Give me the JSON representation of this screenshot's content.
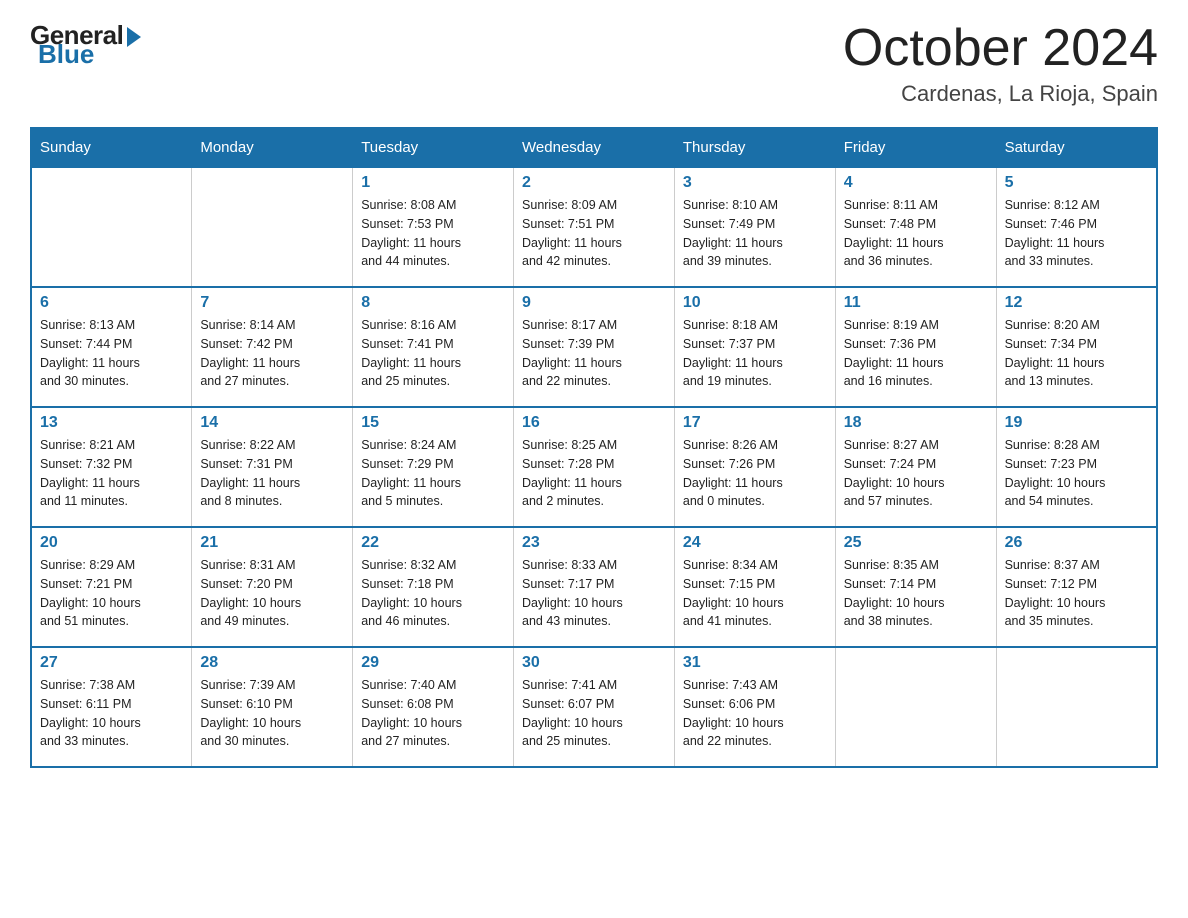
{
  "header": {
    "logo": {
      "general": "General",
      "blue": "Blue"
    },
    "title": "October 2024",
    "location": "Cardenas, La Rioja, Spain"
  },
  "days_of_week": [
    "Sunday",
    "Monday",
    "Tuesday",
    "Wednesday",
    "Thursday",
    "Friday",
    "Saturday"
  ],
  "weeks": [
    [
      {
        "day": "",
        "info": ""
      },
      {
        "day": "",
        "info": ""
      },
      {
        "day": "1",
        "info": "Sunrise: 8:08 AM\nSunset: 7:53 PM\nDaylight: 11 hours\nand 44 minutes."
      },
      {
        "day": "2",
        "info": "Sunrise: 8:09 AM\nSunset: 7:51 PM\nDaylight: 11 hours\nand 42 minutes."
      },
      {
        "day": "3",
        "info": "Sunrise: 8:10 AM\nSunset: 7:49 PM\nDaylight: 11 hours\nand 39 minutes."
      },
      {
        "day": "4",
        "info": "Sunrise: 8:11 AM\nSunset: 7:48 PM\nDaylight: 11 hours\nand 36 minutes."
      },
      {
        "day": "5",
        "info": "Sunrise: 8:12 AM\nSunset: 7:46 PM\nDaylight: 11 hours\nand 33 minutes."
      }
    ],
    [
      {
        "day": "6",
        "info": "Sunrise: 8:13 AM\nSunset: 7:44 PM\nDaylight: 11 hours\nand 30 minutes."
      },
      {
        "day": "7",
        "info": "Sunrise: 8:14 AM\nSunset: 7:42 PM\nDaylight: 11 hours\nand 27 minutes."
      },
      {
        "day": "8",
        "info": "Sunrise: 8:16 AM\nSunset: 7:41 PM\nDaylight: 11 hours\nand 25 minutes."
      },
      {
        "day": "9",
        "info": "Sunrise: 8:17 AM\nSunset: 7:39 PM\nDaylight: 11 hours\nand 22 minutes."
      },
      {
        "day": "10",
        "info": "Sunrise: 8:18 AM\nSunset: 7:37 PM\nDaylight: 11 hours\nand 19 minutes."
      },
      {
        "day": "11",
        "info": "Sunrise: 8:19 AM\nSunset: 7:36 PM\nDaylight: 11 hours\nand 16 minutes."
      },
      {
        "day": "12",
        "info": "Sunrise: 8:20 AM\nSunset: 7:34 PM\nDaylight: 11 hours\nand 13 minutes."
      }
    ],
    [
      {
        "day": "13",
        "info": "Sunrise: 8:21 AM\nSunset: 7:32 PM\nDaylight: 11 hours\nand 11 minutes."
      },
      {
        "day": "14",
        "info": "Sunrise: 8:22 AM\nSunset: 7:31 PM\nDaylight: 11 hours\nand 8 minutes."
      },
      {
        "day": "15",
        "info": "Sunrise: 8:24 AM\nSunset: 7:29 PM\nDaylight: 11 hours\nand 5 minutes."
      },
      {
        "day": "16",
        "info": "Sunrise: 8:25 AM\nSunset: 7:28 PM\nDaylight: 11 hours\nand 2 minutes."
      },
      {
        "day": "17",
        "info": "Sunrise: 8:26 AM\nSunset: 7:26 PM\nDaylight: 11 hours\nand 0 minutes."
      },
      {
        "day": "18",
        "info": "Sunrise: 8:27 AM\nSunset: 7:24 PM\nDaylight: 10 hours\nand 57 minutes."
      },
      {
        "day": "19",
        "info": "Sunrise: 8:28 AM\nSunset: 7:23 PM\nDaylight: 10 hours\nand 54 minutes."
      }
    ],
    [
      {
        "day": "20",
        "info": "Sunrise: 8:29 AM\nSunset: 7:21 PM\nDaylight: 10 hours\nand 51 minutes."
      },
      {
        "day": "21",
        "info": "Sunrise: 8:31 AM\nSunset: 7:20 PM\nDaylight: 10 hours\nand 49 minutes."
      },
      {
        "day": "22",
        "info": "Sunrise: 8:32 AM\nSunset: 7:18 PM\nDaylight: 10 hours\nand 46 minutes."
      },
      {
        "day": "23",
        "info": "Sunrise: 8:33 AM\nSunset: 7:17 PM\nDaylight: 10 hours\nand 43 minutes."
      },
      {
        "day": "24",
        "info": "Sunrise: 8:34 AM\nSunset: 7:15 PM\nDaylight: 10 hours\nand 41 minutes."
      },
      {
        "day": "25",
        "info": "Sunrise: 8:35 AM\nSunset: 7:14 PM\nDaylight: 10 hours\nand 38 minutes."
      },
      {
        "day": "26",
        "info": "Sunrise: 8:37 AM\nSunset: 7:12 PM\nDaylight: 10 hours\nand 35 minutes."
      }
    ],
    [
      {
        "day": "27",
        "info": "Sunrise: 7:38 AM\nSunset: 6:11 PM\nDaylight: 10 hours\nand 33 minutes."
      },
      {
        "day": "28",
        "info": "Sunrise: 7:39 AM\nSunset: 6:10 PM\nDaylight: 10 hours\nand 30 minutes."
      },
      {
        "day": "29",
        "info": "Sunrise: 7:40 AM\nSunset: 6:08 PM\nDaylight: 10 hours\nand 27 minutes."
      },
      {
        "day": "30",
        "info": "Sunrise: 7:41 AM\nSunset: 6:07 PM\nDaylight: 10 hours\nand 25 minutes."
      },
      {
        "day": "31",
        "info": "Sunrise: 7:43 AM\nSunset: 6:06 PM\nDaylight: 10 hours\nand 22 minutes."
      },
      {
        "day": "",
        "info": ""
      },
      {
        "day": "",
        "info": ""
      }
    ]
  ]
}
